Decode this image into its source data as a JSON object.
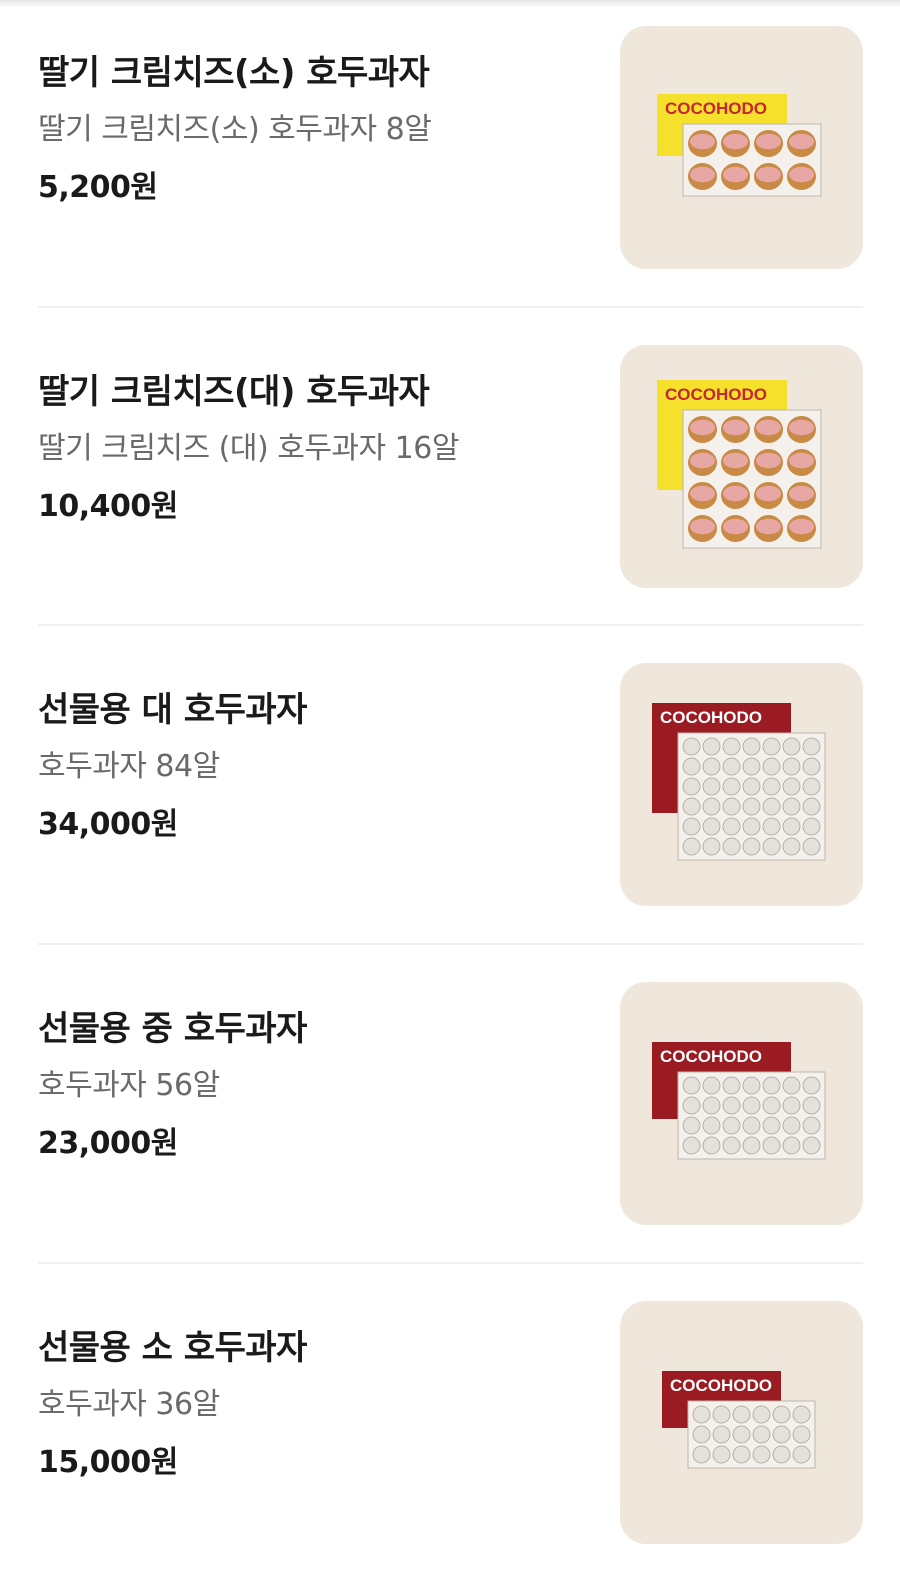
{
  "menu": {
    "items": [
      {
        "name": "딸기 크림치즈(소) 호두과자",
        "description": "딸기 크림치즈(소) 호두과자 8알",
        "price": "5,200원",
        "image": {
          "brand": "COCOHODO",
          "box_color": "#f5e02c",
          "brand_color": "#c4272f",
          "filling": "strawberry",
          "rows": 2,
          "cols": 4,
          "trays": 1
        }
      },
      {
        "name": "딸기 크림치즈(대) 호두과자",
        "description": "딸기 크림치즈 (대) 호두과자 16알",
        "price": "10,400원",
        "image": {
          "brand": "COCOHODO",
          "box_color": "#f5e02c",
          "brand_color": "#c4272f",
          "filling": "strawberry",
          "rows": 4,
          "cols": 4,
          "trays": 1
        }
      },
      {
        "name": "선물용 대 호두과자",
        "description": "호두과자 84알",
        "price": "34,000원",
        "image": {
          "brand": "COCOHODO",
          "box_color": "#9a1b22",
          "brand_color": "#ffffff",
          "filling": "plain",
          "rows": 6,
          "cols": 7,
          "trays": 1
        }
      },
      {
        "name": "선물용 중 호두과자",
        "description": "호두과자 56알",
        "price": "23,000원",
        "image": {
          "brand": "COCOHODO",
          "box_color": "#9a1b22",
          "brand_color": "#ffffff",
          "filling": "plain",
          "rows": 4,
          "cols": 7,
          "trays": 1
        }
      },
      {
        "name": "선물용 소 호두과자",
        "description": "호두과자 36알",
        "price": "15,000원",
        "image": {
          "brand": "COCOHODO",
          "box_color": "#9a1b22",
          "brand_color": "#ffffff",
          "filling": "plain",
          "rows": 3,
          "cols": 6,
          "trays": 1
        }
      }
    ]
  }
}
